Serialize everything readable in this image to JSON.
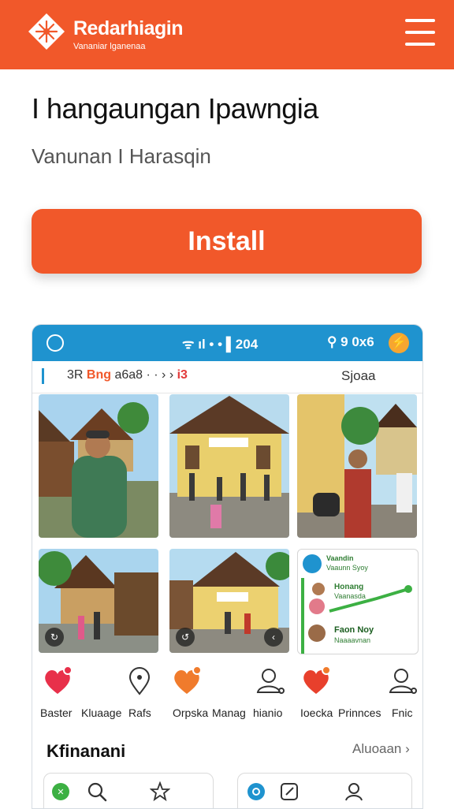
{
  "header": {
    "brand": "Redarhiagin",
    "tagline": "Vananiar lganenaa",
    "menu_icon": "hamburger-menu-icon",
    "colors": {
      "primary": "#f1582a",
      "status_bar": "#1f93cf"
    }
  },
  "app": {
    "title": "I hangaungan Ipawngia",
    "subtitle": "Vanunan I Harasqin",
    "install_label": "Install"
  },
  "phone": {
    "status_mid": "ᯤ ıl • • ▌204",
    "status_right": "⚲ 9 0x6",
    "subbar_left_prefix": "3R",
    "subbar_left_highlight": "Bng",
    "subbar_left_suffix": "a6a8 · · › ›",
    "subbar_left_alert": "i3",
    "subbar_right": "Sjoaa",
    "mini_app": {
      "line1": "Vaandin",
      "line2": "Vaaunn Syoy",
      "item1_title": "Honang",
      "item1_sub": "Vaanasda",
      "item2_title": "Faon Noy",
      "item2_sub": "Naaaavnan"
    },
    "categories": [
      {
        "label": "Baster",
        "icon": "heart-icon"
      },
      {
        "label": "Kluaage",
        "icon": ""
      },
      {
        "label": "Rafs",
        "icon": "location-pin-icon"
      },
      {
        "label": "Orpska",
        "icon": "heart-icon"
      },
      {
        "label": "Manag",
        "icon": ""
      },
      {
        "label": "hianio",
        "icon": "user-icon"
      },
      {
        "label": "Ioecka",
        "icon": "heart-icon"
      },
      {
        "label": "Prinnces",
        "icon": ""
      },
      {
        "label": "Fnic",
        "icon": "user-icon"
      }
    ],
    "section": {
      "title": "Kfinanani",
      "more": "Aluoaan"
    }
  }
}
